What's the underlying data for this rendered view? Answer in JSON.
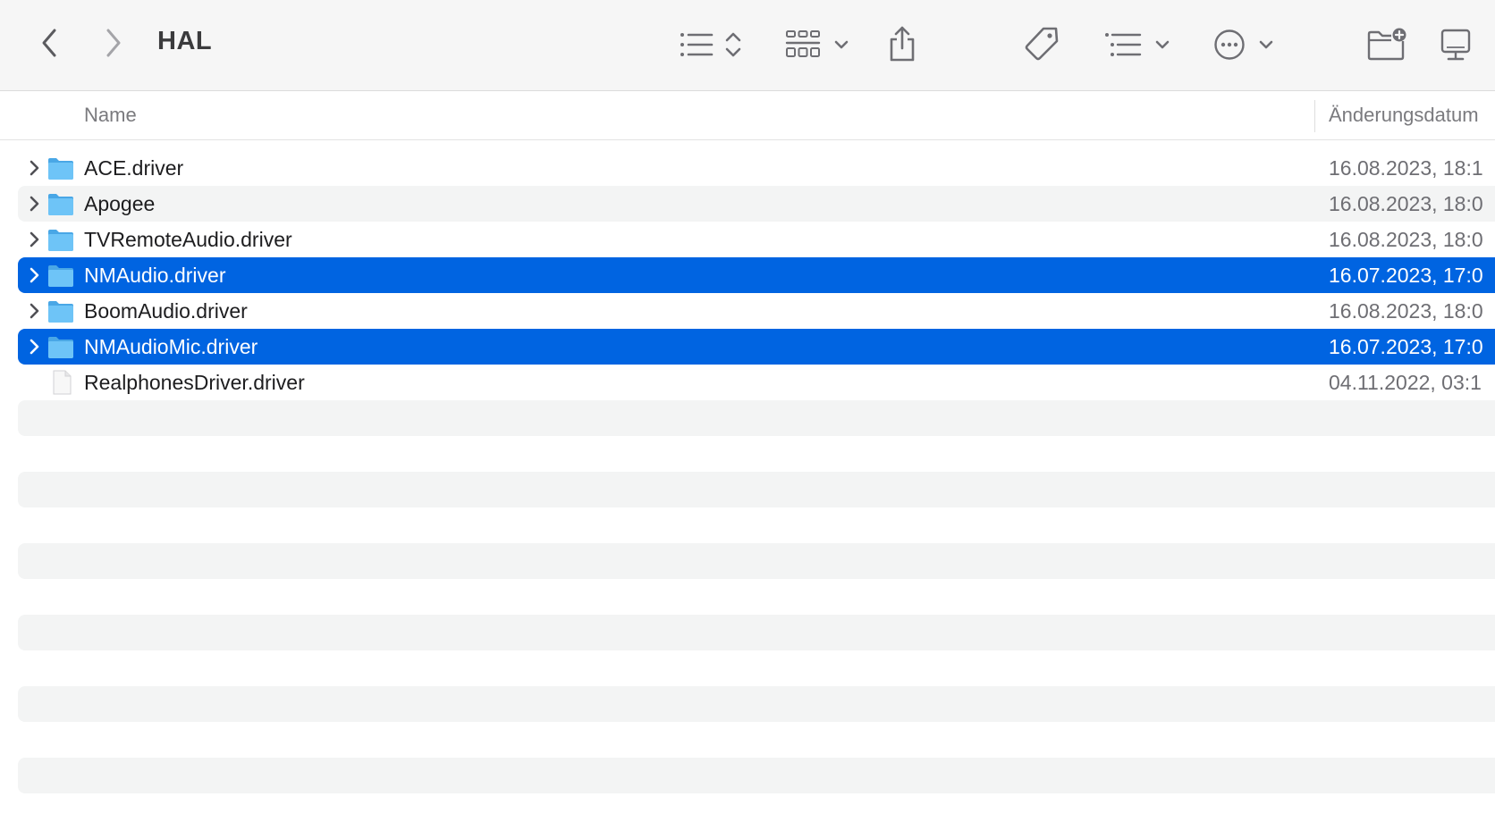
{
  "toolbar": {
    "title": "HAL",
    "icons": [
      "chevron-left-icon",
      "chevron-right-icon",
      "list-view-icon",
      "sort-updown-icon",
      "grid-view-icon",
      "chevron-down-icon",
      "share-icon",
      "tag-icon",
      "group-list-icon",
      "chevron-down-icon",
      "more-circle-icon",
      "chevron-down-icon",
      "new-folder-icon",
      "display-icon"
    ]
  },
  "columns": {
    "name": "Name",
    "date": "Änderungsdatum"
  },
  "files": [
    {
      "name": "ACE.driver",
      "date": "16.08.2023, 18:1",
      "type": "folder",
      "selected": false,
      "expandable": true
    },
    {
      "name": "Apogee",
      "date": "16.08.2023, 18:0",
      "type": "folder",
      "selected": false,
      "expandable": true
    },
    {
      "name": "TVRemoteAudio.driver",
      "date": "16.08.2023, 18:0",
      "type": "folder",
      "selected": false,
      "expandable": true
    },
    {
      "name": "NMAudio.driver",
      "date": "16.07.2023, 17:0",
      "type": "folder",
      "selected": true,
      "expandable": true
    },
    {
      "name": "BoomAudio.driver",
      "date": "16.08.2023, 18:0",
      "type": "folder",
      "selected": false,
      "expandable": true
    },
    {
      "name": "NMAudioMic.driver",
      "date": "16.07.2023, 17:0",
      "type": "folder",
      "selected": true,
      "expandable": true
    },
    {
      "name": "RealphonesDriver.driver",
      "date": "04.11.2022, 03:1",
      "type": "file",
      "selected": false,
      "expandable": false
    }
  ],
  "colors": {
    "selection": "#0064e1",
    "folder_blue": "#5ab8f3",
    "stripe": "#f3f4f4",
    "toolbar_bg": "#f6f6f6"
  }
}
